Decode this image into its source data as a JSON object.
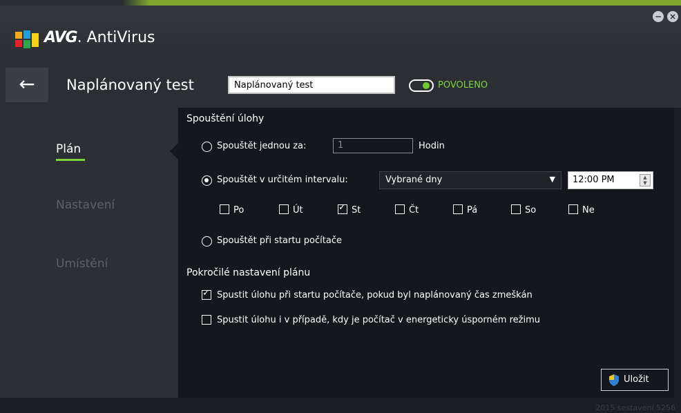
{
  "app": {
    "brand_logo_text": "AVG",
    "brand_product": "AntiVirus"
  },
  "window_controls": {
    "minimize": "−",
    "close": "×"
  },
  "header": {
    "back": "←",
    "title": "Naplánovaný test",
    "name_input_value": "Naplánovaný test",
    "toggle_label": "POVOLENO",
    "toggle_on": true
  },
  "sidebar": {
    "items": [
      {
        "label": "Plán",
        "active": true
      },
      {
        "label": "Nastavení",
        "active": false
      },
      {
        "label": "Umístění",
        "active": false
      }
    ]
  },
  "schedule": {
    "section_title": "Spouštění úlohy",
    "once_label": "Spouštět jednou za:",
    "once_value": "1",
    "once_unit": "Hodin",
    "interval_label": "Spouštět v určitém intervalu:",
    "interval_select": "Vybrané dny",
    "time_value": "12:00 PM",
    "days": [
      {
        "label": "Po",
        "checked": false
      },
      {
        "label": "Út",
        "checked": false
      },
      {
        "label": "St",
        "checked": true
      },
      {
        "label": "Čt",
        "checked": false
      },
      {
        "label": "Pá",
        "checked": false
      },
      {
        "label": "So",
        "checked": false
      },
      {
        "label": "Ne",
        "checked": false
      }
    ],
    "startup_label": "Spouštět při startu počítače",
    "selected": "interval"
  },
  "advanced": {
    "section_title": "Pokročilé nastavení plánu",
    "option1_label": "Spustit úlohu při startu počítače, pokud byl naplánovaný čas zmeškán",
    "option1_checked": true,
    "option2_label": "Spustit úlohu i v případě, kdy je počítač v energeticky úsporném režimu",
    "option2_checked": false
  },
  "actions": {
    "save_label": "Uložit"
  },
  "footer": {
    "build_text": "2015 sestavení 5256"
  },
  "colors": {
    "accent_green": "#7ed33d",
    "panel_bg": "#14171b",
    "sidebar_bg": "#2c3035"
  }
}
